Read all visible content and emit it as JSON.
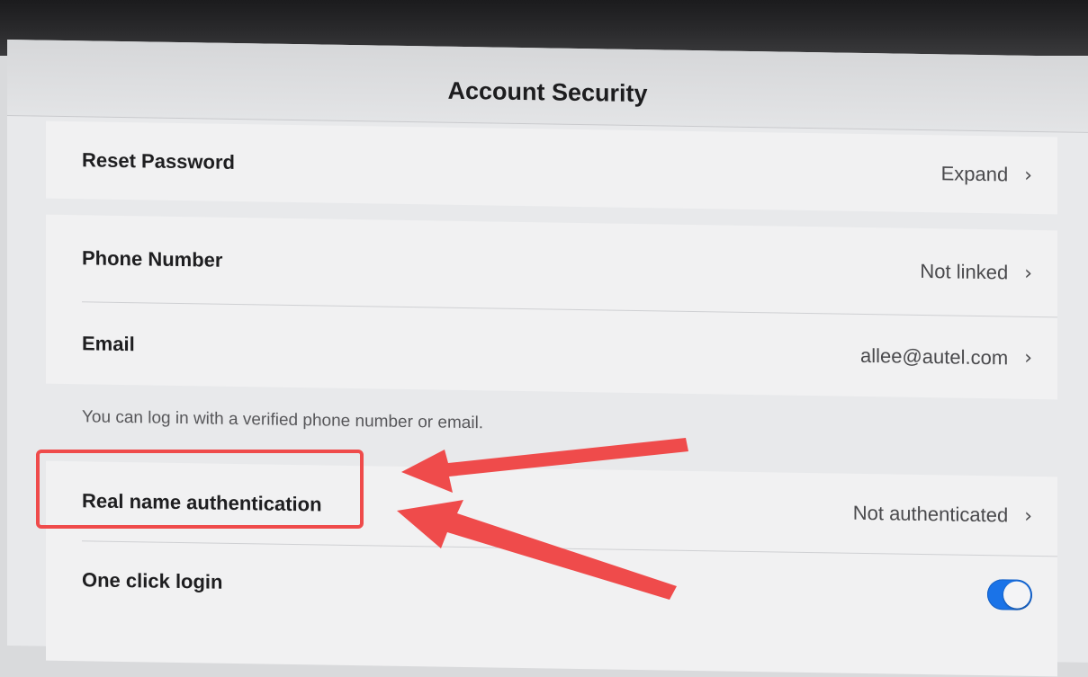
{
  "header": {
    "title": "Account Security"
  },
  "rows": {
    "reset_password": {
      "label": "Reset Password",
      "value": "Expand"
    },
    "phone_number": {
      "label": "Phone Number",
      "value": "Not linked"
    },
    "email": {
      "label": "Email",
      "value": "allee@autel.com"
    },
    "hint": "You can log in with a verified phone number or email.",
    "real_name": {
      "label": "Real name authentication",
      "value": "Not authenticated"
    },
    "one_click_login": {
      "label": "One click login",
      "enabled": true
    }
  },
  "icons": {
    "chevron": "chevron-right-icon"
  },
  "colors": {
    "toggle_on": "#1a73e8",
    "annotation": "#ef4b4b"
  }
}
